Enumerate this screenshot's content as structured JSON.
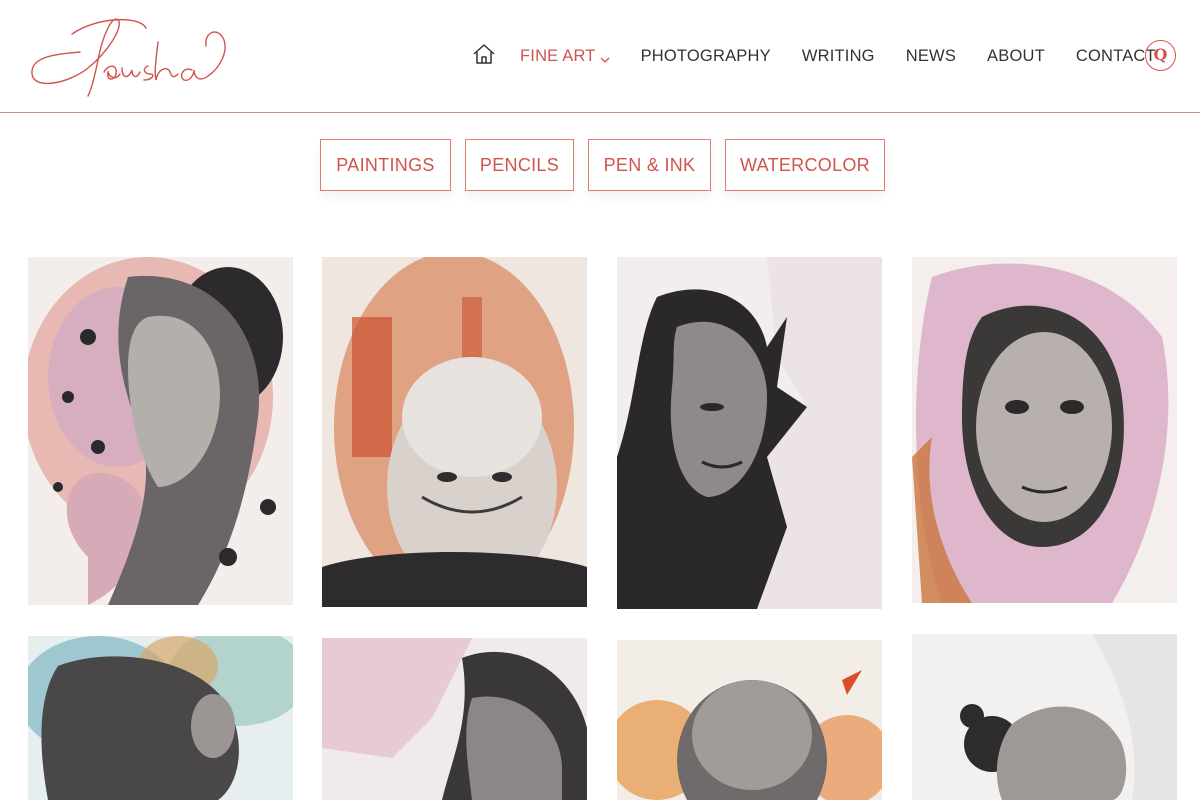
{
  "header": {
    "logo_text": "Pausha",
    "nav": {
      "home_icon": "home-icon",
      "items": [
        {
          "label": "FINE ART",
          "active": true
        },
        {
          "label": "PHOTOGRAPHY"
        },
        {
          "label": "WRITING"
        },
        {
          "label": "NEWS"
        },
        {
          "label": "ABOUT"
        },
        {
          "label": "CONTACT"
        }
      ]
    },
    "search_icon": "search-icon",
    "search_glyph": "Q"
  },
  "filters": [
    "PAINTINGS",
    "PENCILS",
    "PEN & INK",
    "WATERCOLOR"
  ],
  "gallery": [
    "artwork-1",
    "artwork-2",
    "artwork-3",
    "artwork-4",
    "artwork-5",
    "artwork-6",
    "artwork-7",
    "artwork-8"
  ],
  "colors": {
    "accent": "#d0544c",
    "border": "#e07c74",
    "divider": "#d98b86"
  }
}
